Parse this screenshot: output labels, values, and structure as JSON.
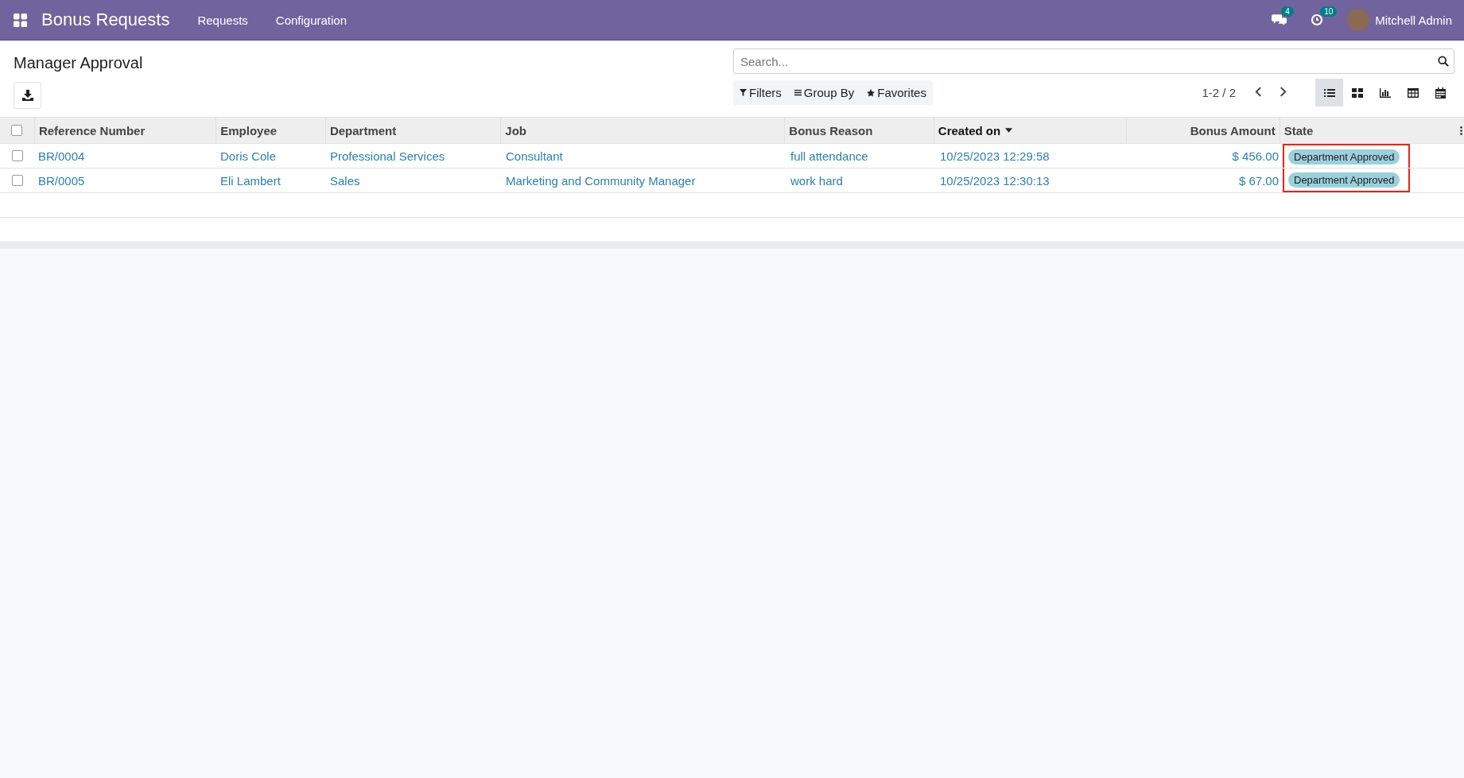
{
  "navbar": {
    "app_title": "Bonus Requests",
    "menus": [
      "Requests",
      "Configuration"
    ],
    "messages_count": "4",
    "activities_count": "10",
    "user": "Mitchell Admin"
  },
  "page": {
    "title": "Manager Approval"
  },
  "search": {
    "placeholder": "Search..."
  },
  "filters": [
    "Filters",
    "Group By",
    "Favorites"
  ],
  "pager": "1-2 / 2",
  "views": [
    {
      "kind": "list",
      "selected": true
    },
    {
      "kind": "kanban",
      "selected": false
    },
    {
      "kind": "graph",
      "selected": false
    },
    {
      "kind": "pivot",
      "selected": false
    },
    {
      "kind": "calendar",
      "selected": false
    }
  ],
  "table": {
    "select_all_checked": false,
    "columns": [
      {
        "label": "Reference Number",
        "kind": "link",
        "sorted": false
      },
      {
        "label": "Employee",
        "kind": "link",
        "sorted": false
      },
      {
        "label": "Department",
        "kind": "link",
        "sorted": false
      },
      {
        "label": "Job",
        "kind": "link",
        "sorted": false
      },
      {
        "label": "Bonus Reason",
        "kind": "link",
        "sorted": false
      },
      {
        "label": "Created on",
        "kind": "link",
        "sorted": true
      },
      {
        "label": "Bonus Amount",
        "kind": "amount",
        "sorted": false
      },
      {
        "label": "State",
        "kind": "status",
        "sorted": false,
        "highlighted": true
      }
    ],
    "rows": [
      {
        "checked": false,
        "cells": [
          "BR/0004",
          "Doris Cole",
          "Professional Services",
          "Consultant",
          "full attendance",
          "10/25/2023 12:29:58",
          "$ 456.00",
          "Department Approved"
        ]
      },
      {
        "checked": false,
        "cells": [
          "BR/0005",
          "Eli Lambert",
          "Sales",
          "Marketing and Community Manager",
          "work hard",
          "10/25/2023 12:30:13",
          "$ 67.00",
          "Department Approved"
        ]
      }
    ]
  }
}
